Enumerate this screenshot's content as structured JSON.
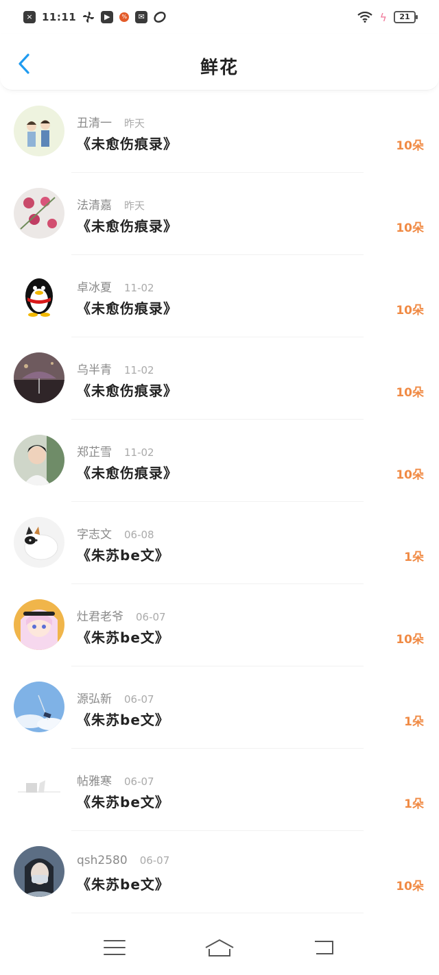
{
  "status_bar": {
    "time": "11:11",
    "battery": "21",
    "icons": [
      "x-icon",
      "fan-icon",
      "play-icon",
      "app-icon",
      "mail-icon",
      "leaf-icon",
      "wifi-icon",
      "charging-icon"
    ]
  },
  "header": {
    "title": "鲜花",
    "back_icon": "chevron-left-icon"
  },
  "colors": {
    "accent": "#1f9bf0",
    "amount": "#f08a44",
    "name": "#8a8a8a",
    "time": "#aaaaaa"
  },
  "items": [
    {
      "name": "丑清一",
      "time": "昨天",
      "work": "《未愈伤痕录》",
      "amount": "10朵",
      "avatar": "cartoon-couple"
    },
    {
      "name": "法清嘉",
      "time": "昨天",
      "work": "《未愈伤痕录》",
      "amount": "10朵",
      "avatar": "flowers"
    },
    {
      "name": "卓冰夏",
      "time": "11-02",
      "work": "《未愈伤痕录》",
      "amount": "10朵",
      "avatar": "penguin"
    },
    {
      "name": "乌半青",
      "time": "11-02",
      "work": "《未愈伤痕录》",
      "amount": "10朵",
      "avatar": "umbrella"
    },
    {
      "name": "郑芷雪",
      "time": "11-02",
      "work": "《未愈伤痕录》",
      "amount": "10朵",
      "avatar": "boy"
    },
    {
      "name": "字志文",
      "time": "06-08",
      "work": "《朱苏be文》",
      "amount": "1朵",
      "avatar": "cat"
    },
    {
      "name": "灶君老爷",
      "time": "06-07",
      "work": "《朱苏be文》",
      "amount": "10朵",
      "avatar": "anime-girl"
    },
    {
      "name": "源弘新",
      "time": "06-07",
      "work": "《朱苏be文》",
      "amount": "1朵",
      "avatar": "sky"
    },
    {
      "name": "帖雅寒",
      "time": "06-07",
      "work": "《朱苏be文》",
      "amount": "1朵",
      "avatar": "white-scene"
    },
    {
      "name": "qsh2580",
      "time": "06-07",
      "work": "《朱苏be文》",
      "amount": "10朵",
      "avatar": "masked-girl"
    }
  ],
  "nav": {
    "menu_icon": "menu-icon",
    "home_icon": "home-icon",
    "back_icon": "back-icon"
  }
}
